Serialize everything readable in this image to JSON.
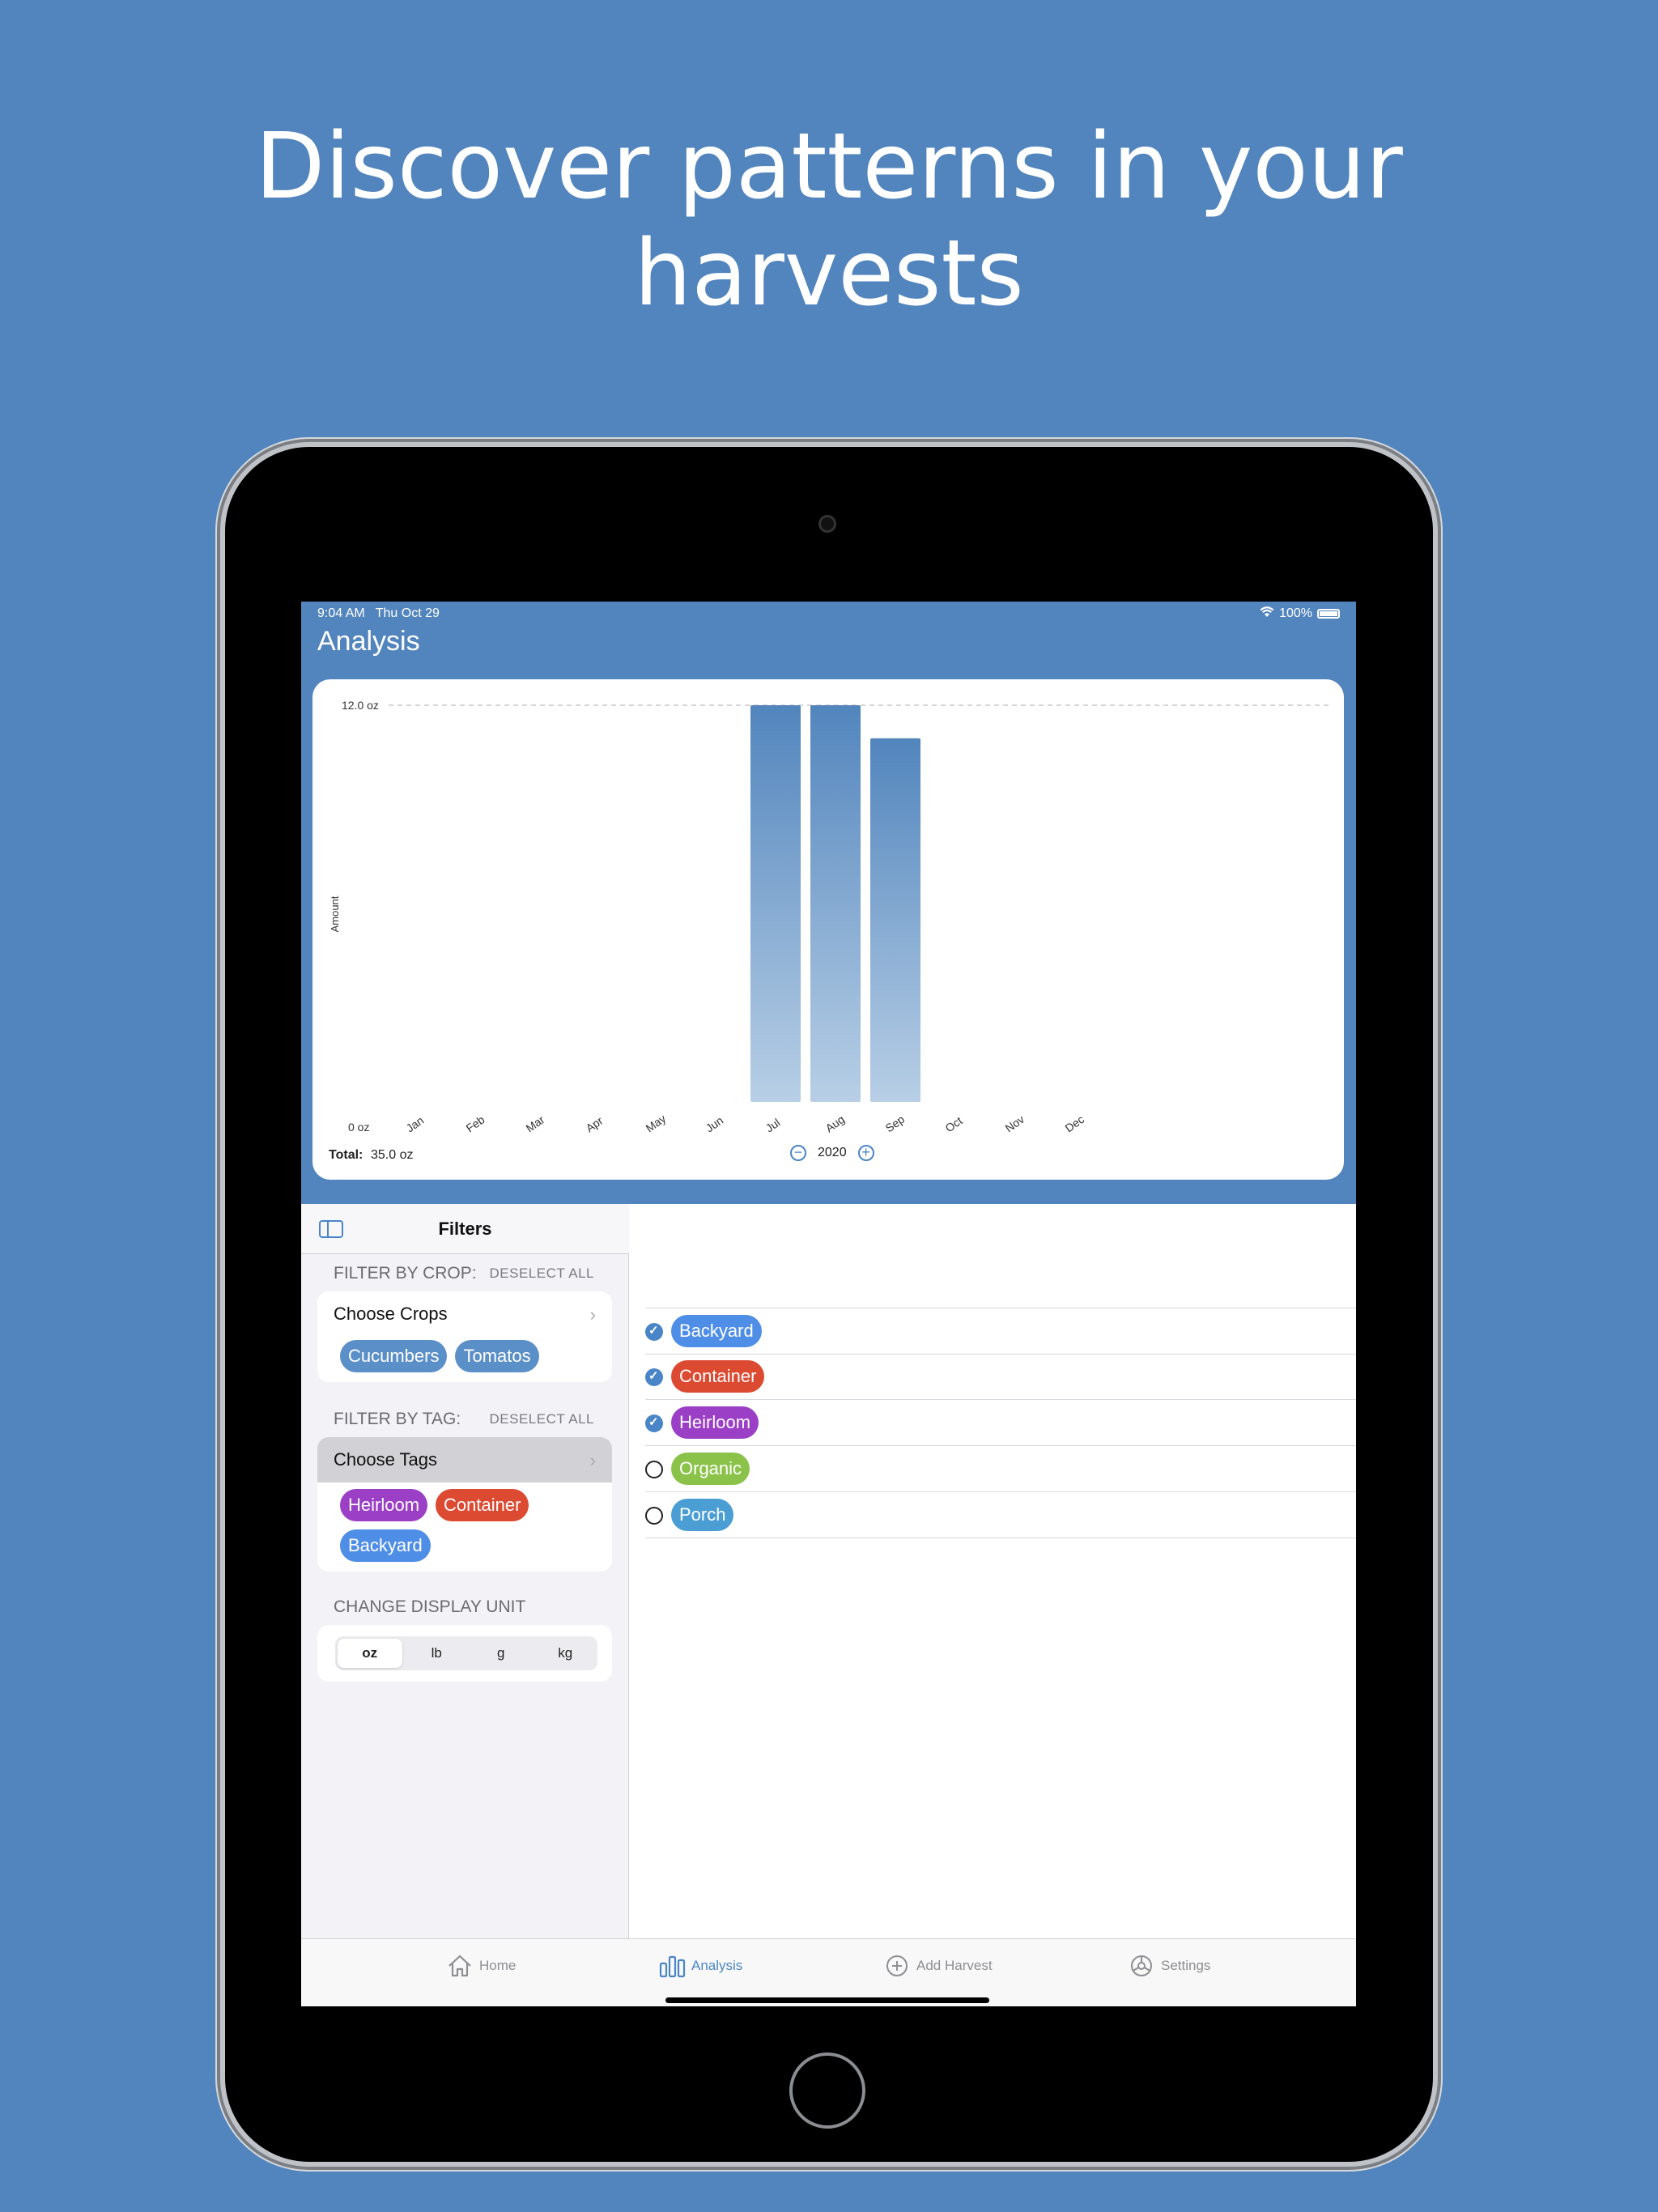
{
  "headline": {
    "line1": "Discover patterns in your",
    "line2": "harvests"
  },
  "status_bar": {
    "time": "9:04 AM",
    "date": "Thu Oct 29",
    "battery": "100%"
  },
  "nav": {
    "title": "Analysis"
  },
  "chart_data": {
    "type": "bar",
    "categories": [
      "Jan",
      "Feb",
      "Mar",
      "Apr",
      "May",
      "Jun",
      "Jul",
      "Aug",
      "Sep",
      "Oct",
      "Nov",
      "Dec"
    ],
    "values": [
      0,
      0,
      0,
      0,
      0,
      0,
      12.0,
      12.0,
      11.0,
      0,
      0,
      0
    ],
    "ylabel": "Amount",
    "ytick_labels": [
      "0 oz",
      "12.0 oz"
    ],
    "ylim": [
      0,
      12.0
    ],
    "reference_line": 12.0,
    "bar_color_top": "#5285bd",
    "bar_color_bottom": "#b8cfe6"
  },
  "chart_footer": {
    "total_label": "Total:",
    "total_value": "35.0 oz",
    "year": "2020",
    "minus": "−",
    "plus": "+"
  },
  "sidebar": {
    "title": "Filters",
    "crop_section": {
      "header": "FILTER BY CROP:",
      "deselect": "DESELECT ALL",
      "row_label": "Choose Crops",
      "chips": [
        {
          "label": "Cucumbers",
          "color": "#5b8fc7"
        },
        {
          "label": "Tomatos",
          "color": "#5b8fc7"
        }
      ]
    },
    "tag_section": {
      "header": "FILTER BY TAG:",
      "deselect": "DESELECT ALL",
      "row_label": "Choose Tags",
      "chips": [
        {
          "label": "Heirloom",
          "color": "#9b3fc6"
        },
        {
          "label": "Container",
          "color": "#dc4a32"
        },
        {
          "label": "Backyard",
          "color": "#4f8ee6"
        }
      ]
    },
    "unit_section": {
      "header": "CHANGE DISPLAY UNIT",
      "options": [
        "oz",
        "lb",
        "g",
        "kg"
      ],
      "selected": "oz"
    }
  },
  "tags": [
    {
      "label": "Backyard",
      "color": "#4f8ee6",
      "checked": true
    },
    {
      "label": "Container",
      "color": "#dc4a32",
      "checked": true
    },
    {
      "label": "Heirloom",
      "color": "#9b3fc6",
      "checked": true
    },
    {
      "label": "Organic",
      "color": "#8bc34a",
      "checked": false
    },
    {
      "label": "Porch",
      "color": "#4a9ed4",
      "checked": false
    }
  ],
  "tabbar": {
    "home": "Home",
    "analysis": "Analysis",
    "add_harvest": "Add Harvest",
    "settings": "Settings"
  }
}
